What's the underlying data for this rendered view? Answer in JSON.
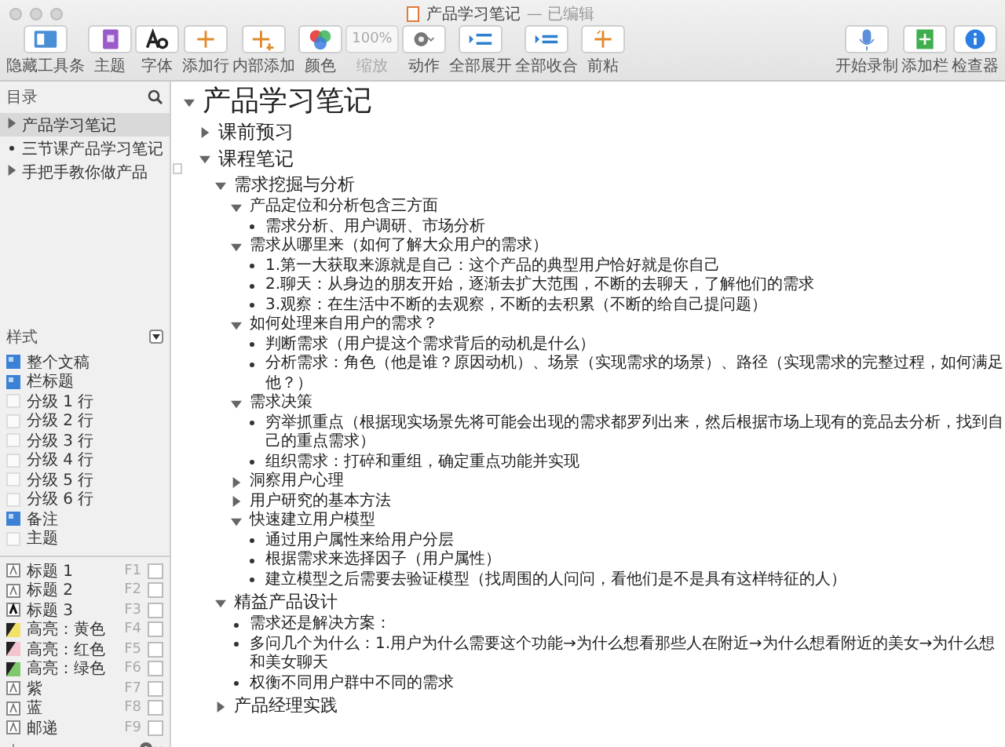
{
  "window": {
    "title": "产品学习笔记",
    "status": "— 已编辑"
  },
  "toolbar": {
    "left": [
      {
        "label": "隐藏工具条",
        "kind": "button"
      },
      {
        "label": "主题",
        "kind": "button"
      },
      {
        "label": "字体",
        "kind": "button"
      },
      {
        "label": "添加行",
        "kind": "button"
      },
      {
        "label": "内部添加",
        "kind": "button"
      },
      {
        "label": "颜色",
        "kind": "button"
      },
      {
        "label": "缩放",
        "kind": "zoom",
        "value": "100%",
        "disabled": true
      },
      {
        "label": "动作",
        "kind": "menu"
      },
      {
        "label": "全部展开",
        "kind": "button"
      },
      {
        "label": "全部收合",
        "kind": "button"
      },
      {
        "label": "前粘",
        "kind": "button"
      }
    ],
    "right": [
      {
        "label": "开始录制",
        "kind": "button"
      },
      {
        "label": "添加栏",
        "kind": "button"
      },
      {
        "label": "检查器",
        "kind": "button"
      }
    ]
  },
  "sidebar": {
    "title": "目录",
    "items": [
      {
        "label": "产品学习笔记",
        "expanded": false,
        "selected": true
      },
      {
        "label": "三节课产品学习笔记",
        "selected": false
      },
      {
        "label": "手把手教你做产品",
        "expanded": false,
        "selected": false
      }
    ],
    "styles_title": "样式",
    "styles": [
      {
        "label": "整个文稿",
        "checked": true
      },
      {
        "label": "栏标题",
        "checked": true
      },
      {
        "label": "分级 1 行",
        "checked": false
      },
      {
        "label": "分级 2 行",
        "checked": false
      },
      {
        "label": "分级 3 行",
        "checked": false
      },
      {
        "label": "分级 4 行",
        "checked": false
      },
      {
        "label": "分级 5 行",
        "checked": false
      },
      {
        "label": "分级 6 行",
        "checked": false
      },
      {
        "label": "备注",
        "checked": true
      },
      {
        "label": "主题",
        "checked": false
      }
    ],
    "named_styles": [
      {
        "label": "标题 1",
        "shortcut": "F1",
        "kind": "heading",
        "checked": false
      },
      {
        "label": "标题 2",
        "shortcut": "F2",
        "kind": "heading",
        "checked": false
      },
      {
        "label": "标题 3",
        "shortcut": "F3",
        "kind": "strong",
        "checked": false
      },
      {
        "label": "高亮：黄色",
        "shortcut": "F4",
        "kind": "highlight",
        "color": "#f2e26a",
        "checked": false
      },
      {
        "label": "高亮：红色",
        "shortcut": "F5",
        "kind": "highlight",
        "color": "#f4c4d0",
        "checked": false
      },
      {
        "label": "高亮：绿色",
        "shortcut": "F6",
        "kind": "highlight",
        "color": "#7fc96d",
        "checked": false
      },
      {
        "label": "紫",
        "shortcut": "F7",
        "kind": "heading",
        "checked": false
      },
      {
        "label": "蓝",
        "shortcut": "F8",
        "kind": "heading",
        "checked": false
      },
      {
        "label": "邮递",
        "shortcut": "F9",
        "kind": "heading",
        "checked": false
      }
    ]
  },
  "outline": {
    "text": "产品学习笔记",
    "expanded": true,
    "children": [
      {
        "text": "课前预习",
        "expanded": false
      },
      {
        "text": "课程笔记",
        "expanded": true,
        "children": [
          {
            "text": "需求挖掘与分析",
            "expanded": true,
            "children": [
              {
                "text": "产品定位和分析包含三方面",
                "expanded": true,
                "children": [
                  {
                    "text": "需求分析、用户调研、市场分析"
                  }
                ]
              },
              {
                "text": "需求从哪里来（如何了解大众用户的需求）",
                "expanded": true,
                "children": [
                  {
                    "text": "1.第一大获取来源就是自己：这个产品的典型用户恰好就是你自己"
                  },
                  {
                    "text": "2.聊天：从身边的朋友开始，逐渐去扩大范围，不断的去聊天，了解他们的需求"
                  },
                  {
                    "text": "3.观察：在生活中不断的去观察，不断的去积累（不断的给自己提问题）"
                  }
                ]
              },
              {
                "text": "如何处理来自用户的需求？",
                "expanded": true,
                "children": [
                  {
                    "text": "判断需求（用户提这个需求背后的动机是什么）"
                  },
                  {
                    "text": "分析需求：角色（他是谁？原因动机）、场景（实现需求的场景）、路径（实现需求的完整过程，如何满足他？）"
                  }
                ]
              },
              {
                "text": "需求决策",
                "expanded": true,
                "children": [
                  {
                    "text": "穷举抓重点（根据现实场景先将可能会出现的需求都罗列出来，然后根据市场上现有的竞品去分析，找到自己的重点需求）"
                  },
                  {
                    "text": "组织需求：打碎和重组，确定重点功能并实现"
                  }
                ]
              },
              {
                "text": "洞察用户心理",
                "expanded": false
              },
              {
                "text": "用户研究的基本方法",
                "expanded": false
              },
              {
                "text": "快速建立用户模型",
                "expanded": true,
                "children": [
                  {
                    "text": "通过用户属性来给用户分层"
                  },
                  {
                    "text": "根据需求来选择因子（用户属性）"
                  },
                  {
                    "text": "建立模型之后需要去验证模型（找周围的人问问，看他们是不是具有这样特征的人）"
                  }
                ]
              }
            ]
          },
          {
            "text": "精益产品设计",
            "expanded": true,
            "children": [
              {
                "text": "需求还是解决方案："
              },
              {
                "text": "多问几个为什么：1.用户为什么需要这个功能→为什么想看那些人在附近→为什么想看附近的美女→为什么想和美女聊天"
              },
              {
                "text": "权衡不同用户群中不同的需求"
              }
            ]
          },
          {
            "text": "产品经理实践",
            "expanded": false
          }
        ]
      }
    ]
  }
}
